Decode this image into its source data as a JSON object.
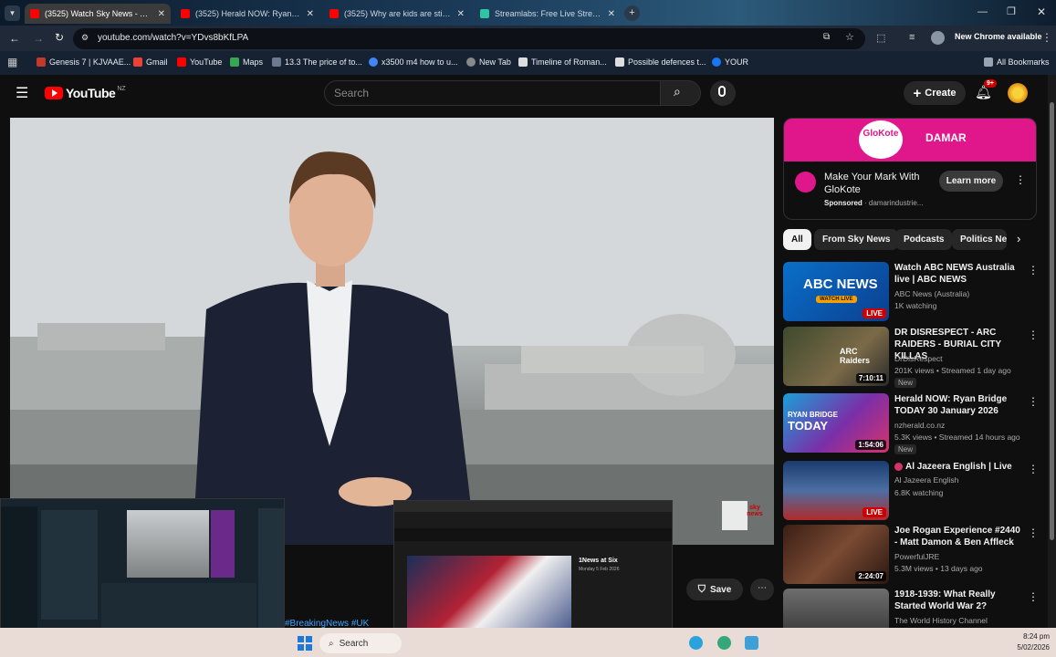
{
  "tabs": [
    {
      "title": "(3525) Watch Sky News - YouTube",
      "active": true
    },
    {
      "title": "(3525) Herald NOW: Ryan Bridge",
      "active": false
    },
    {
      "title": "(3525) Why are kids are still ...",
      "active": false
    },
    {
      "title": "Streamlabs: Free Live Streaming",
      "active": false
    }
  ],
  "address": {
    "url": "youtube.com/watch?v=YDvs8bKfLPA",
    "update_label": "New Chrome available"
  },
  "bookmarks": [
    {
      "label": "Genesis 7 | KJVAAE...",
      "color": "#c0392b"
    },
    {
      "label": "Gmail",
      "color": "#ea4335"
    },
    {
      "label": "YouTube",
      "color": "#ff0000"
    },
    {
      "label": "Maps",
      "color": "#34a853"
    },
    {
      "label": "13.3 The price of to...",
      "color": "#6b7a8f"
    },
    {
      "label": "x3500 m4 how to u...",
      "color": "#4285f4"
    },
    {
      "label": "New Tab",
      "color": "#888888"
    },
    {
      "label": "Timeline of Roman...",
      "color": "#dddddd"
    },
    {
      "label": "Possible defences t...",
      "color": "#dddddd"
    },
    {
      "label": "YOUR",
      "color": "#1877f2"
    }
  ],
  "all_bookmarks": "All Bookmarks",
  "youtube": {
    "logo": "YouTube",
    "region": "NZ",
    "search_placeholder": "Search",
    "create_label": "Create",
    "notif_count": "9+"
  },
  "video": {
    "hashtags": "#BreakingNews #UK",
    "save_label": "Save",
    "watermark": "sky news"
  },
  "ad": {
    "brand": "GloKote",
    "brand2": "DAMAR",
    "title": "Make Your Mark With GloKote",
    "sponsored": "Sponsored",
    "domain": "damarindustrie...",
    "cta": "Learn more"
  },
  "chips": [
    "All",
    "From Sky News",
    "Podcasts",
    "Politics Ne"
  ],
  "recs": [
    {
      "title": "Watch ABC NEWS Australia live | ABC NEWS",
      "channel": "ABC News (Australia)",
      "meta": "1K watching",
      "badge": "LIVE",
      "new": ""
    },
    {
      "title": "DR DISRESPECT - ARC RAIDERS - BURIAL CITY KILLAS",
      "channel": "DrDisRespect",
      "meta": "201K views • Streamed 1 day ago",
      "badge": "7:10:11",
      "new": "New"
    },
    {
      "title": "Herald NOW: Ryan Bridge TODAY 30 January 2026",
      "channel": "nzherald.co.nz",
      "meta": "5.3K views • Streamed 14 hours ago",
      "badge": "1:54:06",
      "new": "New"
    },
    {
      "title": "Al Jazeera English | Live",
      "channel": "Al Jazeera English",
      "meta": "6.8K watching",
      "badge": "LIVE",
      "new": ""
    },
    {
      "title": "Joe Rogan Experience #2440 - Matt Damon & Ben Affleck",
      "channel": "PowerfulJRE",
      "meta": "5.3M views • 13 days ago",
      "badge": "2:24:07",
      "new": ""
    },
    {
      "title": "1918-1939: What Really Started World War 2?",
      "channel": "The World History Channel",
      "meta": "",
      "badge": "",
      "new": ""
    }
  ],
  "thumb_text": {
    "abc": "ABC NEWS",
    "abc_sub": "WATCH LIVE",
    "arc": "ARC Raiders",
    "ryan": "RYAN BRIDGE",
    "today": "TODAY"
  },
  "taskbar": {
    "search": "Search",
    "time": "8:24 pm",
    "date": "5/02/2026"
  },
  "overlay_news": {
    "title": "1News at Six",
    "date": "Monday 5 Feb 2026"
  }
}
